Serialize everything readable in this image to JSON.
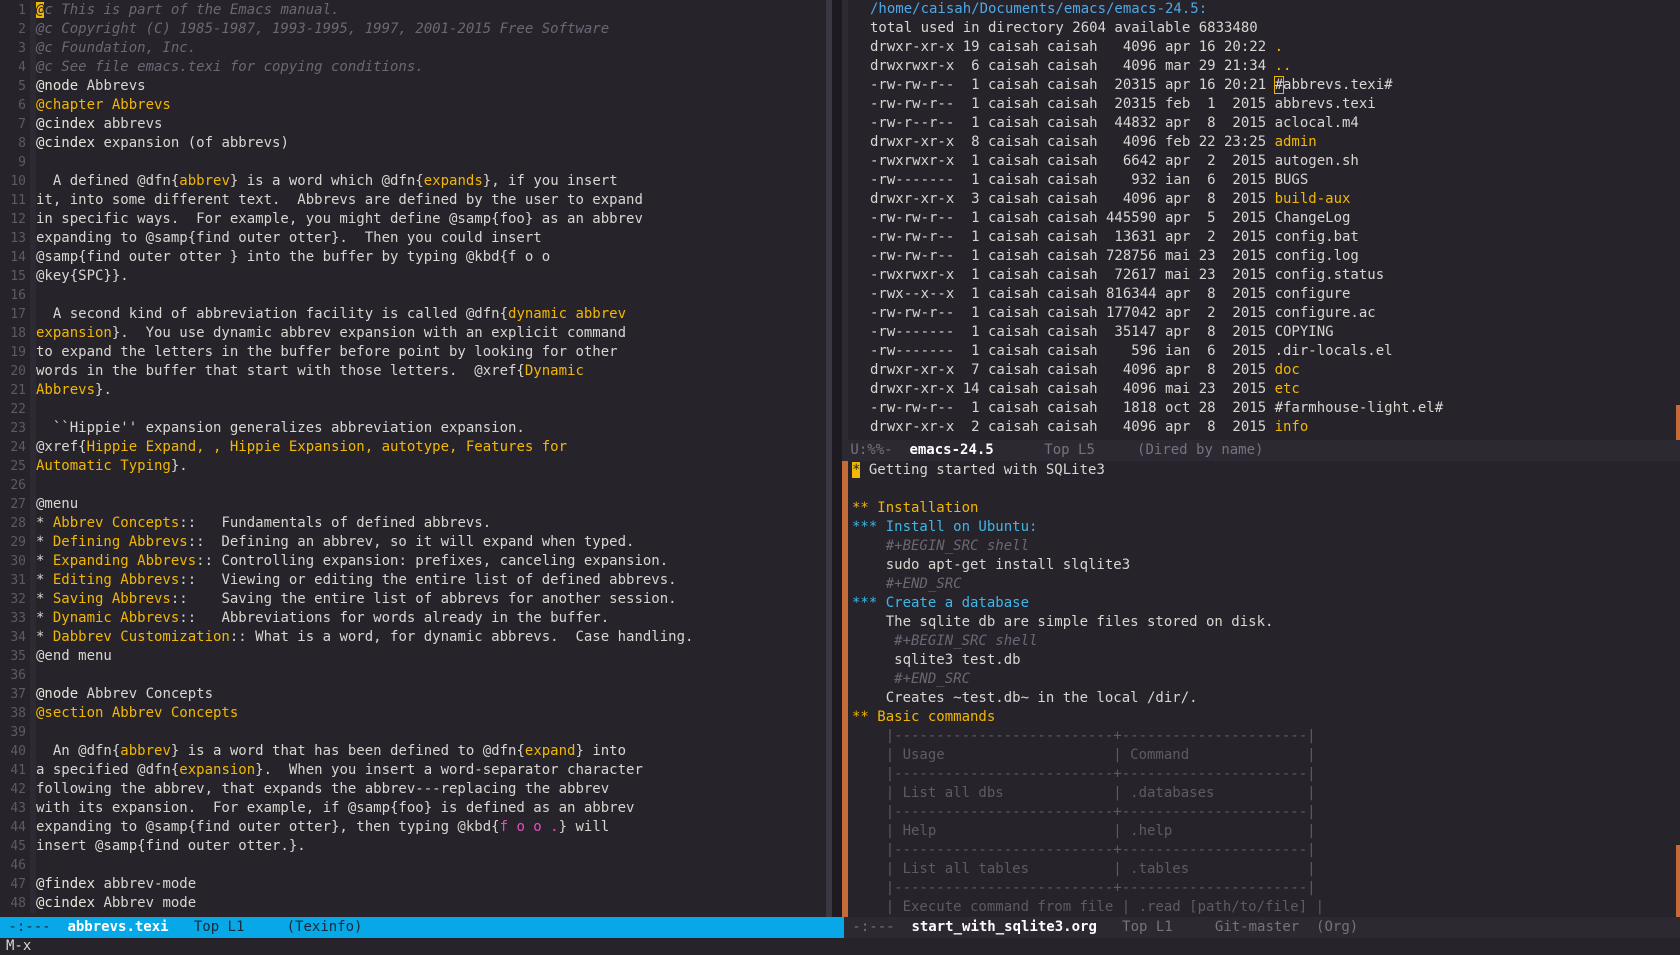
{
  "left_buffer": {
    "lines": [
      {
        "n": "1",
        "segs": [
          {
            "t": "@c This is part of the Emacs manual.",
            "c": "comment"
          }
        ]
      },
      {
        "n": "2",
        "segs": [
          {
            "t": "@c Copyright (C) 1985-1987, 1993-1995, 1997, 2001-2015 Free Software",
            "c": "comment"
          }
        ]
      },
      {
        "n": "3",
        "segs": [
          {
            "t": "@c Foundation, Inc.",
            "c": "comment"
          }
        ]
      },
      {
        "n": "4",
        "segs": [
          {
            "t": "@c See file emacs.texi for copying conditions.",
            "c": "comment"
          }
        ]
      },
      {
        "n": "5",
        "segs": [
          {
            "t": "@node",
            "c": "kw"
          },
          {
            "t": " Abbrevs",
            "c": "plain"
          }
        ]
      },
      {
        "n": "6",
        "segs": [
          {
            "t": "@chapter Abbrevs",
            "c": "yel"
          }
        ]
      },
      {
        "n": "7",
        "segs": [
          {
            "t": "@cindex",
            "c": "kw"
          },
          {
            "t": " abbrevs",
            "c": "plain"
          }
        ]
      },
      {
        "n": "8",
        "segs": [
          {
            "t": "@cindex",
            "c": "kw"
          },
          {
            "t": " expansion (of abbrevs)",
            "c": "plain"
          }
        ]
      },
      {
        "n": "9",
        "segs": []
      },
      {
        "n": "10",
        "segs": [
          {
            "t": "  A defined @dfn{",
            "c": "plain"
          },
          {
            "t": "abbrev",
            "c": "yel"
          },
          {
            "t": "} is a word which @dfn{",
            "c": "plain"
          },
          {
            "t": "expands",
            "c": "yel"
          },
          {
            "t": "}, if you insert",
            "c": "plain"
          }
        ]
      },
      {
        "n": "11",
        "segs": [
          {
            "t": "it, into some different text.  Abbrevs are defined by the user to expand",
            "c": "plain"
          }
        ]
      },
      {
        "n": "12",
        "segs": [
          {
            "t": "in specific ways.  For example, you might define @samp{foo} as an abbrev",
            "c": "plain"
          }
        ]
      },
      {
        "n": "13",
        "segs": [
          {
            "t": "expanding to @samp{find outer otter}.  Then you could insert",
            "c": "plain"
          }
        ]
      },
      {
        "n": "14",
        "segs": [
          {
            "t": "@samp{find outer otter } into the buffer by typing @kbd{f o o",
            "c": "plain"
          }
        ]
      },
      {
        "n": "15",
        "segs": [
          {
            "t": "@key{SPC}}.",
            "c": "plain"
          }
        ]
      },
      {
        "n": "16",
        "segs": []
      },
      {
        "n": "17",
        "segs": [
          {
            "t": "  A second kind of abbreviation facility is called @dfn{",
            "c": "plain"
          },
          {
            "t": "dynamic abbrev",
            "c": "yel"
          }
        ]
      },
      {
        "n": "18",
        "segs": [
          {
            "t": "expansion",
            "c": "yel"
          },
          {
            "t": "}.  You use dynamic abbrev expansion with an explicit command",
            "c": "plain"
          }
        ]
      },
      {
        "n": "19",
        "segs": [
          {
            "t": "to expand the letters in the buffer before point by looking for other",
            "c": "plain"
          }
        ]
      },
      {
        "n": "20",
        "segs": [
          {
            "t": "words in the buffer that start with those letters.  @xref{",
            "c": "plain"
          },
          {
            "t": "Dynamic",
            "c": "yel"
          }
        ]
      },
      {
        "n": "21",
        "segs": [
          {
            "t": "Abbrevs",
            "c": "yel"
          },
          {
            "t": "}.",
            "c": "plain"
          }
        ]
      },
      {
        "n": "22",
        "segs": []
      },
      {
        "n": "23",
        "segs": [
          {
            "t": "  ``Hippie'' expansion generalizes abbreviation expansion.",
            "c": "plain"
          }
        ]
      },
      {
        "n": "24",
        "segs": [
          {
            "t": "@xref{",
            "c": "plain"
          },
          {
            "t": "Hippie Expand, , Hippie Expansion, autotype, Features for",
            "c": "yel"
          }
        ]
      },
      {
        "n": "25",
        "segs": [
          {
            "t": "Automatic Typing",
            "c": "yel"
          },
          {
            "t": "}.",
            "c": "plain"
          }
        ]
      },
      {
        "n": "26",
        "segs": []
      },
      {
        "n": "27",
        "segs": [
          {
            "t": "@menu",
            "c": "plain"
          }
        ]
      },
      {
        "n": "28",
        "segs": [
          {
            "t": "* ",
            "c": "plain"
          },
          {
            "t": "Abbrev Concepts",
            "c": "yel"
          },
          {
            "t": "::   Fundamentals of defined abbrevs.",
            "c": "plain"
          }
        ]
      },
      {
        "n": "29",
        "segs": [
          {
            "t": "* ",
            "c": "plain"
          },
          {
            "t": "Defining Abbrevs",
            "c": "yel"
          },
          {
            "t": "::  Defining an abbrev, so it will expand when typed.",
            "c": "plain"
          }
        ]
      },
      {
        "n": "30",
        "segs": [
          {
            "t": "* ",
            "c": "plain"
          },
          {
            "t": "Expanding Abbrevs",
            "c": "yel"
          },
          {
            "t": ":: Controlling expansion: prefixes, canceling expansion.",
            "c": "plain"
          }
        ]
      },
      {
        "n": "31",
        "segs": [
          {
            "t": "* ",
            "c": "plain"
          },
          {
            "t": "Editing Abbrevs",
            "c": "yel"
          },
          {
            "t": "::   Viewing or editing the entire list of defined abbrevs.",
            "c": "plain"
          }
        ]
      },
      {
        "n": "32",
        "segs": [
          {
            "t": "* ",
            "c": "plain"
          },
          {
            "t": "Saving Abbrevs",
            "c": "yel"
          },
          {
            "t": "::    Saving the entire list of abbrevs for another session.",
            "c": "plain"
          }
        ]
      },
      {
        "n": "33",
        "segs": [
          {
            "t": "* ",
            "c": "plain"
          },
          {
            "t": "Dynamic Abbrevs",
            "c": "yel"
          },
          {
            "t": "::   Abbreviations for words already in the buffer.",
            "c": "plain"
          }
        ]
      },
      {
        "n": "34",
        "segs": [
          {
            "t": "* ",
            "c": "plain"
          },
          {
            "t": "Dabbrev Customization",
            "c": "yel"
          },
          {
            "t": ":: What is a word, for dynamic abbrevs.  Case handling.",
            "c": "plain"
          }
        ]
      },
      {
        "n": "35",
        "segs": [
          {
            "t": "@end menu",
            "c": "plain"
          }
        ]
      },
      {
        "n": "36",
        "segs": []
      },
      {
        "n": "37",
        "segs": [
          {
            "t": "@node",
            "c": "kw"
          },
          {
            "t": " Abbrev Concepts",
            "c": "plain"
          }
        ]
      },
      {
        "n": "38",
        "segs": [
          {
            "t": "@section Abbrev Concepts",
            "c": "yel"
          }
        ]
      },
      {
        "n": "39",
        "segs": []
      },
      {
        "n": "40",
        "segs": [
          {
            "t": "  An @dfn{",
            "c": "plain"
          },
          {
            "t": "abbrev",
            "c": "yel"
          },
          {
            "t": "} is a word that has been defined to @dfn{",
            "c": "plain"
          },
          {
            "t": "expand",
            "c": "yel"
          },
          {
            "t": "} into",
            "c": "plain"
          }
        ]
      },
      {
        "n": "41",
        "segs": [
          {
            "t": "a specified @dfn{",
            "c": "plain"
          },
          {
            "t": "expansion",
            "c": "yel"
          },
          {
            "t": "}.  When you insert a word-separator character",
            "c": "plain"
          }
        ]
      },
      {
        "n": "42",
        "segs": [
          {
            "t": "following the abbrev, that expands the abbrev---replacing the abbrev",
            "c": "plain"
          }
        ]
      },
      {
        "n": "43",
        "segs": [
          {
            "t": "with its expansion.  For example, if @samp{foo} is defined as an abbrev",
            "c": "plain"
          }
        ]
      },
      {
        "n": "44",
        "segs": [
          {
            "t": "expanding to @samp{find outer otter}, then typing @kbd{",
            "c": "plain"
          },
          {
            "t": "f o o .",
            "c": "mag"
          },
          {
            "t": "} will",
            "c": "plain"
          }
        ]
      },
      {
        "n": "45",
        "segs": [
          {
            "t": "insert @samp{find outer otter.}.",
            "c": "plain"
          }
        ]
      },
      {
        "n": "46",
        "segs": []
      },
      {
        "n": "47",
        "segs": [
          {
            "t": "@findex",
            "c": "kw"
          },
          {
            "t": " abbrev-mode",
            "c": "plain"
          }
        ]
      },
      {
        "n": "48",
        "segs": [
          {
            "t": "@cindex",
            "c": "kw"
          },
          {
            "t": " Abbrev mode",
            "c": "plain"
          }
        ]
      }
    ]
  },
  "dired": {
    "header": "/home/caisah/Documents/emacs/emacs-24.5:",
    "summary": "total used in directory 2604 available 6833480",
    "rows": [
      {
        "meta": "drwxr-xr-x 19 caisah caisah   4096 apr 16 20:22 ",
        "name": ".",
        "dir": true
      },
      {
        "meta": "drwxrwxr-x  6 caisah caisah   4096 mar 29 21:34 ",
        "name": "..",
        "dir": true
      },
      {
        "meta": "-rw-rw-r--  1 caisah caisah  20315 apr 16 20:21 ",
        "name": "#abbrevs.texi#",
        "dir": false,
        "cursor": true
      },
      {
        "meta": "-rw-rw-r--  1 caisah caisah  20315 feb  1  2015 ",
        "name": "abbrevs.texi",
        "dir": false
      },
      {
        "meta": "-rw-r--r--  1 caisah caisah  44832 apr  8  2015 ",
        "name": "aclocal.m4",
        "dir": false
      },
      {
        "meta": "drwxr-xr-x  8 caisah caisah   4096 feb 22 23:25 ",
        "name": "admin",
        "dir": true
      },
      {
        "meta": "-rwxrwxr-x  1 caisah caisah   6642 apr  2  2015 ",
        "name": "autogen.sh",
        "dir": false
      },
      {
        "meta": "-rw-------  1 caisah caisah    932 ian  6  2015 ",
        "name": "BUGS",
        "dir": false
      },
      {
        "meta": "drwxr-xr-x  3 caisah caisah   4096 apr  8  2015 ",
        "name": "build-aux",
        "dir": true
      },
      {
        "meta": "-rw-rw-r--  1 caisah caisah 445590 apr  5  2015 ",
        "name": "ChangeLog",
        "dir": false
      },
      {
        "meta": "-rw-rw-r--  1 caisah caisah  13631 apr  2  2015 ",
        "name": "config.bat",
        "dir": false
      },
      {
        "meta": "-rw-rw-r--  1 caisah caisah 728756 mai 23  2015 ",
        "name": "config.log",
        "dir": false
      },
      {
        "meta": "-rwxrwxr-x  1 caisah caisah  72617 mai 23  2015 ",
        "name": "config.status",
        "dir": false
      },
      {
        "meta": "-rwx--x--x  1 caisah caisah 816344 apr  8  2015 ",
        "name": "configure",
        "dir": false
      },
      {
        "meta": "-rw-rw-r--  1 caisah caisah 177042 apr  2  2015 ",
        "name": "configure.ac",
        "dir": false
      },
      {
        "meta": "-rw-------  1 caisah caisah  35147 apr  8  2015 ",
        "name": "COPYING",
        "dir": false
      },
      {
        "meta": "-rw-------  1 caisah caisah    596 ian  6  2015 ",
        "name": ".dir-locals.el",
        "dir": false
      },
      {
        "meta": "drwxr-xr-x  7 caisah caisah   4096 apr  8  2015 ",
        "name": "doc",
        "dir": true
      },
      {
        "meta": "drwxr-xr-x 14 caisah caisah   4096 mai 23  2015 ",
        "name": "etc",
        "dir": true
      },
      {
        "meta": "-rw-rw-r--  1 caisah caisah   1818 oct 28  2015 ",
        "name": "#farmhouse-light.el#",
        "dir": false
      },
      {
        "meta": "drwxr-xr-x  2 caisah caisah   4096 apr  8  2015 ",
        "name": "info",
        "dir": true
      }
    ]
  },
  "org": {
    "rows": [
      {
        "segs": [
          {
            "t": "*",
            "c": "cursor"
          },
          {
            "t": " Getting started with SQLite3",
            "c": "plain"
          }
        ]
      },
      {
        "segs": []
      },
      {
        "segs": [
          {
            "t": "** Installation",
            "c": "org-y"
          }
        ]
      },
      {
        "segs": [
          {
            "t": "*** Install on Ubuntu:",
            "c": "cyan"
          }
        ]
      },
      {
        "segs": [
          {
            "t": "    #+BEGIN_SRC shell",
            "c": "comment"
          }
        ]
      },
      {
        "segs": [
          {
            "t": "    sudo apt-get install slqlite3",
            "c": "plain"
          }
        ]
      },
      {
        "segs": [
          {
            "t": "    #+END_SRC",
            "c": "comment"
          }
        ]
      },
      {
        "segs": [
          {
            "t": "*** Create a database",
            "c": "cyan"
          }
        ]
      },
      {
        "segs": [
          {
            "t": "    The sqlite db are simple files stored on disk.",
            "c": "plain"
          }
        ]
      },
      {
        "segs": [
          {
            "t": "     #+BEGIN_SRC shell",
            "c": "comment"
          }
        ]
      },
      {
        "segs": [
          {
            "t": "     sqlite3 test.db",
            "c": "plain"
          }
        ]
      },
      {
        "segs": [
          {
            "t": "     #+END_SRC",
            "c": "comment"
          }
        ]
      },
      {
        "segs": [
          {
            "t": "    Creates ~test.db~ in the local /dir/.",
            "c": "plain"
          }
        ]
      },
      {
        "segs": [
          {
            "t": "** Basic commands",
            "c": "org-y"
          }
        ]
      },
      {
        "segs": [
          {
            "t": "    |--------------------------+----------------------|",
            "c": "tbl"
          }
        ]
      },
      {
        "segs": [
          {
            "t": "    | Usage                    | Command              |",
            "c": "tbl"
          }
        ]
      },
      {
        "segs": [
          {
            "t": "    |--------------------------+----------------------|",
            "c": "tbl"
          }
        ]
      },
      {
        "segs": [
          {
            "t": "    | List all dbs             | .databases           |",
            "c": "tbl"
          }
        ]
      },
      {
        "segs": [
          {
            "t": "    |--------------------------+----------------------|",
            "c": "tbl"
          }
        ]
      },
      {
        "segs": [
          {
            "t": "    | Help                     | .help                |",
            "c": "tbl"
          }
        ]
      },
      {
        "segs": [
          {
            "t": "    |--------------------------+----------------------|",
            "c": "tbl"
          }
        ]
      },
      {
        "segs": [
          {
            "t": "    | List all tables          | .tables              |",
            "c": "tbl"
          }
        ]
      },
      {
        "segs": [
          {
            "t": "    |--------------------------+----------------------|",
            "c": "tbl"
          }
        ]
      },
      {
        "segs": [
          {
            "t": "    | Execute command from file | .read [path/to/file] |",
            "c": "tbl"
          }
        ]
      }
    ]
  },
  "modelines": {
    "left": {
      "status": " -:---  ",
      "name": "abbrevs.texi",
      "pos": "   Top L1     ",
      "mode": "(Texinfo)"
    },
    "mid": {
      "status": " U:%%-  ",
      "name": "emacs-24.5",
      "pos": "      Top L5     ",
      "mode": "(Dired by name)"
    },
    "right": {
      "status": " -:---  ",
      "name": "start_with_sqlite3.org",
      "pos": "   Top L1     ",
      "mode": "Git-master  (Org)"
    }
  },
  "minibuffer": "M-x"
}
